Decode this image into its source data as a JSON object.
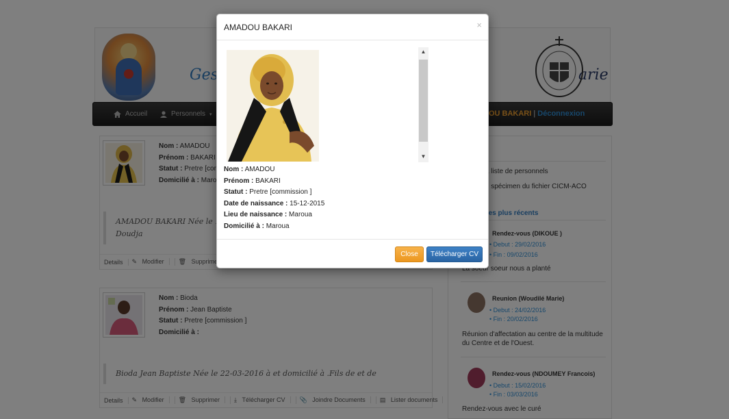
{
  "banner": {
    "title_left": "Gesti",
    "title_right": "arie"
  },
  "nav": {
    "home_label": "Accueil",
    "personnel_label": "Personnels",
    "user_label": "DOU BAKARI",
    "separator": "|",
    "logout_label": "Déconnexion"
  },
  "cards": [
    {
      "nom_label": "Nom :",
      "nom": "AMADOU",
      "prenom_label": "Prénom :",
      "prenom": "BAKARI",
      "statut_label": "Statut :",
      "statut": "Pretre [com",
      "domicile_label": "Domicilié à :",
      "domicile": "Marou",
      "quote": "AMADOU BAKARI Née le 15-12",
      "quote_line2": "Doudja",
      "actions": [
        "Details",
        "Modifier",
        "Supprimer"
      ]
    },
    {
      "nom_label": "Nom :",
      "nom": "Bioda",
      "prenom_label": "Prénom :",
      "prenom": "Jean Baptiste",
      "statut_label": "Statut :",
      "statut": "Pretre [commission ]",
      "domicile_label": "Domicilié à :",
      "domicile": "",
      "quote": "Bioda Jean Baptiste Née le 22-03-2016 à et domicilié à .Fils de et de",
      "actions": [
        "Details",
        "Modifier",
        "Supprimer",
        "Télécharger CV",
        "Joindre Documents",
        "Lister documents"
      ]
    }
  ],
  "sidebar": {
    "section1_title": "es",
    "link1": "harger la liste de personnels",
    "link2": "harger le spécimen du fichier CICM-ACO",
    "section2_title": "ements les plus récents",
    "events": [
      {
        "title": "Rendez-vous (DIKOUE )",
        "debut": "Debut : 29/02/2016",
        "fin": "Fin : 09/02/2016",
        "desc": "La soeur soeur nous a planté"
      },
      {
        "title": "Reunion (Woudilé Marie)",
        "debut": "Debut : 24/02/2016",
        "fin": "Fin : 20/02/2016",
        "desc": "Réunion d'affectation au centre de la multitude du Centre et de l'Ouest."
      },
      {
        "title": "Rendez-vous (NDOUMEY Francois)",
        "debut": "Debut : 15/02/2016",
        "fin": "Fin : 03/03/2016",
        "desc": "Rendez-vous avec le curé"
      }
    ]
  },
  "modal": {
    "title": "AMADOU BAKARI",
    "close_symbol": "×",
    "fields": [
      {
        "label": "Nom :",
        "value": "AMADOU"
      },
      {
        "label": "Prénom :",
        "value": "BAKARI"
      },
      {
        "label": "Statut :",
        "value": "Pretre [commission ]"
      },
      {
        "label": "Date de naissance :",
        "value": "15-12-2015"
      },
      {
        "label": "Lieu de naissance :",
        "value": "Maroua"
      },
      {
        "label": "Domicilié à :",
        "value": "Maroua"
      }
    ],
    "close_button": "Close",
    "download_button": "Télécharger CV"
  },
  "colors": {
    "accent_blue": "#2f7bc0",
    "link_blue": "#2f8fd6",
    "warning_orange": "#ec971f",
    "primary_blue": "#2a64a3",
    "user_orange": "#f0a030"
  }
}
